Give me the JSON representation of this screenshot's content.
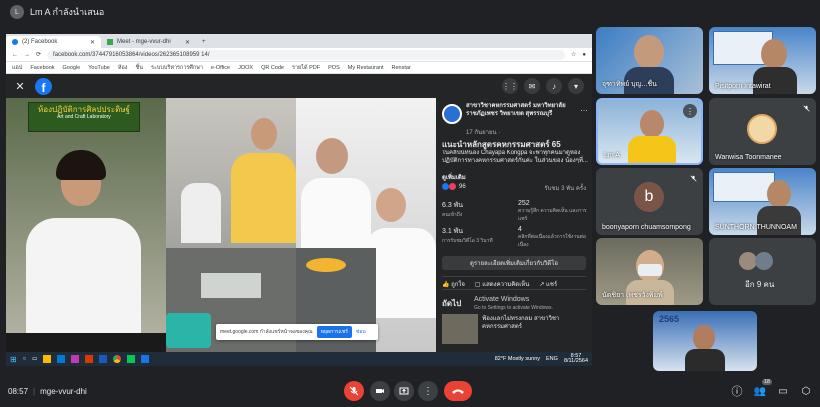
{
  "presenter": {
    "avatar": "L",
    "label": "Lm A กำลังนำเสนอ"
  },
  "browser": {
    "tabs": [
      {
        "label": "(2) Facebook"
      },
      {
        "label": "Meet - mge-vvur-dhi"
      }
    ],
    "url": "facebook.com/37447916053864/videos/262365108959 14/",
    "bookmarks": [
      "แอป",
      "Facebook",
      "Google",
      "YouTube",
      "ห้อง",
      "ชิ้น",
      "ระบบบริหารการศึกษา",
      "e-Office",
      "JOOX",
      "QR Code",
      "รายได้ PDF",
      "POS",
      "My Restaurant",
      "Renstar"
    ]
  },
  "video": {
    "sign_text": "ห้องปฏิบัติการศิลปประดิษฐ์",
    "sign_sub": "Art and Craft Laboratory"
  },
  "post": {
    "page_name": "สาขาวิชาคหกรรมศาสตร์ มหาวิทยาลัยราชภัฏเพชร วิทยาเขต สุพรรณบุรี",
    "date": "17 กันยายน ·",
    "title": "แนะนำหลักสูตรคหกรรมศาสตร์ 65",
    "desc": "ในคลิปนี้ที่น้อง Chayapa Kongpa จะพาทุกคนมาดูห้องปฏิบัติการทางคหกรรมศาสตร์กันค่ะ ในส่วนของ น้องๆที่...",
    "see_more": "ดูเพิ่มเติม",
    "reactions": "96",
    "views": "รับชม 3 พัน ครั้ง",
    "stats": [
      {
        "value": "6.3 พัน",
        "label": "คนเข้าถึง"
      },
      {
        "value": "252",
        "label": "ความรู้สึก ความคิดเห็น และการแชร์"
      },
      {
        "value": "3.1 พัน",
        "label": "การรับชมวิดีโอ 3 วินาที"
      },
      {
        "value": "4",
        "label": "คลิกที่ต่อเนื่องแล้วการใช้งานต่อเนื่อง"
      }
    ],
    "boost": "ดูรายละเอียดเพิ่มเติมเกี่ยวกับวิดีโอ",
    "like": "ถูกใจ",
    "comment": "แสดงความคิดเห็น",
    "share": "แชร์",
    "next_label": "ถัดไป",
    "activate_title": "Activate Windows",
    "activate_sub": "Go to Settings to activate Windows.",
    "next_item": "ฟ้องแลกไม่ทรงกลม สาขาวิชาคหกรรมศาสตร์"
  },
  "share_notice": {
    "text": "meet.google.com กำลังแชร์หน้าจอของคุณ",
    "stop": "หยุดการแชร์",
    "hide": "ซ่อน"
  },
  "taskbar": {
    "weather": "82°F  Mostly sunny",
    "lang": "ENG",
    "time": "8:57",
    "date": "8/11/2564"
  },
  "participants": [
    {
      "name": "จุฑาทิพย์ บุญ...ชื่น"
    },
    {
      "name": "Pisitporn Intawirat"
    },
    {
      "name": "Lm A"
    },
    {
      "name": "Wanwisa Toonmanee"
    },
    {
      "name": "boonyaporn chuamsompong",
      "initial": "b"
    },
    {
      "name": "SUNTHORN THUNNOAM"
    },
    {
      "name": "นัดชิยา เพชรวังพิมพ์"
    },
    {
      "name": "อีก 9 คน"
    }
  ],
  "self_tile": {
    "label": "2565"
  },
  "bottom": {
    "time": "08:57",
    "meeting_code": "mge-vvur-dhi",
    "participant_count": "18"
  },
  "colors": {
    "meet_bg": "#202124",
    "tile_bg": "#3c4043",
    "red": "#ea4335",
    "fb_blue": "#1877f2",
    "fb_dark": "#242526"
  }
}
